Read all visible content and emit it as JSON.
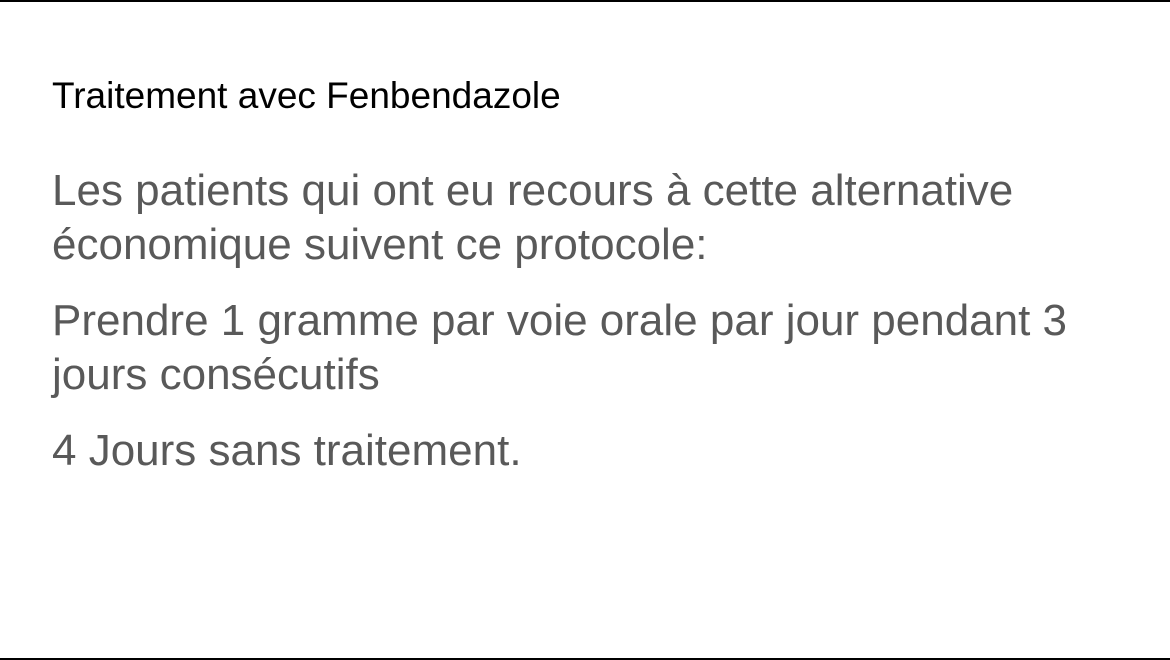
{
  "slide": {
    "title": "Traitement avec Fenbendazole",
    "paragraphs": [
      "Les patients qui ont eu recours à cette alternative économique suivent ce protocole:",
      "Prendre 1 gramme par voie orale par jour pendant 3 jours consécutifs",
      "4 Jours sans traitement."
    ]
  },
  "colors": {
    "title": "#000000",
    "body": "#595959",
    "background": "#ffffff",
    "border": "#000000"
  }
}
